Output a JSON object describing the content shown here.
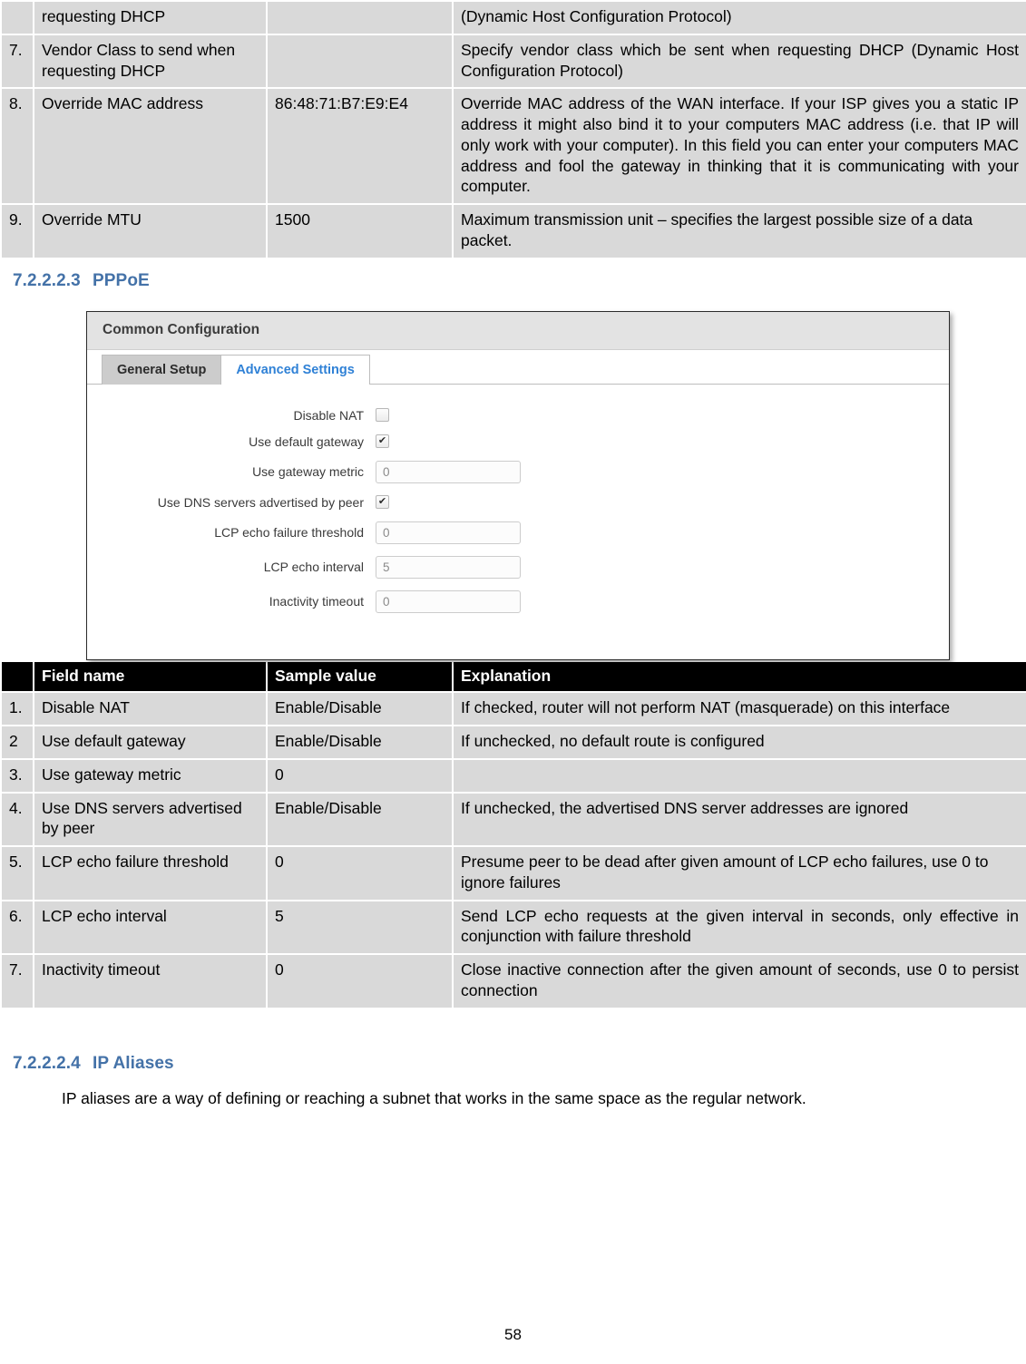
{
  "top_table": {
    "columns": [
      "",
      "Field name",
      "Sample value",
      "Explanation"
    ],
    "rows": [
      {
        "num": "",
        "field": "requesting DHCP",
        "value": "",
        "explanation": "(Dynamic Host Configuration Protocol)"
      },
      {
        "num": "7.",
        "field": "Vendor Class to send when requesting DHCP",
        "value": "",
        "explanation": "Specify vendor class which be sent when requesting DHCP (Dynamic Host Configuration Protocol)"
      },
      {
        "num": "8.",
        "field": "Override MAC address",
        "value": "86:48:71:B7:E9:E4",
        "explanation": "Override MAC address of the WAN interface. If your ISP gives you a static IP address it might also bind it to your computers MAC address (i.e. that IP will only work with your computer). In this field you can enter your computers MAC address and fool the gateway in thinking that it is communicating with your computer."
      },
      {
        "num": "9.",
        "field": "Override MTU",
        "value": "1500",
        "explanation": "Maximum transmission unit – specifies the largest possible size of a data packet."
      }
    ]
  },
  "section_pppoe": {
    "number": "7.2.2.2.3",
    "title": "PPPoE"
  },
  "screenshot": {
    "panel_title": "Common Configuration",
    "tabs": [
      {
        "label": "General Setup",
        "active": false
      },
      {
        "label": "Advanced Settings",
        "active": true
      }
    ],
    "fields": [
      {
        "label": "Disable NAT",
        "type": "checkbox",
        "checked": false
      },
      {
        "label": "Use default gateway",
        "type": "checkbox",
        "checked": true
      },
      {
        "label": "Use gateway metric",
        "type": "text",
        "value": "0"
      },
      {
        "label": "Use DNS servers advertised by peer",
        "type": "checkbox",
        "checked": true
      },
      {
        "label": "LCP echo failure threshold",
        "type": "text",
        "value": "0"
      },
      {
        "label": "LCP echo interval",
        "type": "text",
        "value": "5"
      },
      {
        "label": "Inactivity timeout",
        "type": "text",
        "value": "0"
      }
    ]
  },
  "bottom_table": {
    "columns": [
      "",
      "Field name",
      "Sample value",
      "Explanation"
    ],
    "rows": [
      {
        "num": "1.",
        "field": "Disable NAT",
        "value": "Enable/Disable",
        "explanation": "If checked, router will not perform NAT (masquerade) on this interface",
        "justify": true
      },
      {
        "num": "2",
        "field": "Use default gateway",
        "value": "Enable/Disable",
        "explanation": "If unchecked, no default route is configured",
        "justify": false
      },
      {
        "num": "3.",
        "field": "Use gateway metric",
        "value": "0",
        "explanation": "",
        "justify": false
      },
      {
        "num": "4.",
        "field": "Use DNS servers advertised by peer",
        "value": "Enable/Disable",
        "explanation": "If unchecked, the advertised DNS server addresses are ignored",
        "justify": false
      },
      {
        "num": "5.",
        "field": "LCP echo failure threshold",
        "value": "0",
        "explanation": "Presume peer to be dead after given amount of LCP echo failures, use 0 to ignore failures",
        "justify": false
      },
      {
        "num": "6.",
        "field": "LCP echo interval",
        "value": "5",
        "explanation": "Send LCP echo requests at the given interval in seconds, only effective in conjunction with failure threshold",
        "justify": true
      },
      {
        "num": "7.",
        "field": "Inactivity timeout",
        "value": "0",
        "explanation": "Close inactive connection after the given amount of seconds, use 0 to persist connection",
        "justify": true
      }
    ]
  },
  "section_ip_aliases": {
    "number": "7.2.2.2.4",
    "title": "IP Aliases",
    "paragraph": "IP aliases are a way of defining or reaching a subnet that works in the same space as the regular network."
  },
  "footer": {
    "page_number": "58"
  },
  "colors": {
    "heading": "#4472a8",
    "table_cell_bg": "#d9d9d9",
    "table_header_bg": "#000000",
    "tab_active_text": "#2f81d6"
  }
}
